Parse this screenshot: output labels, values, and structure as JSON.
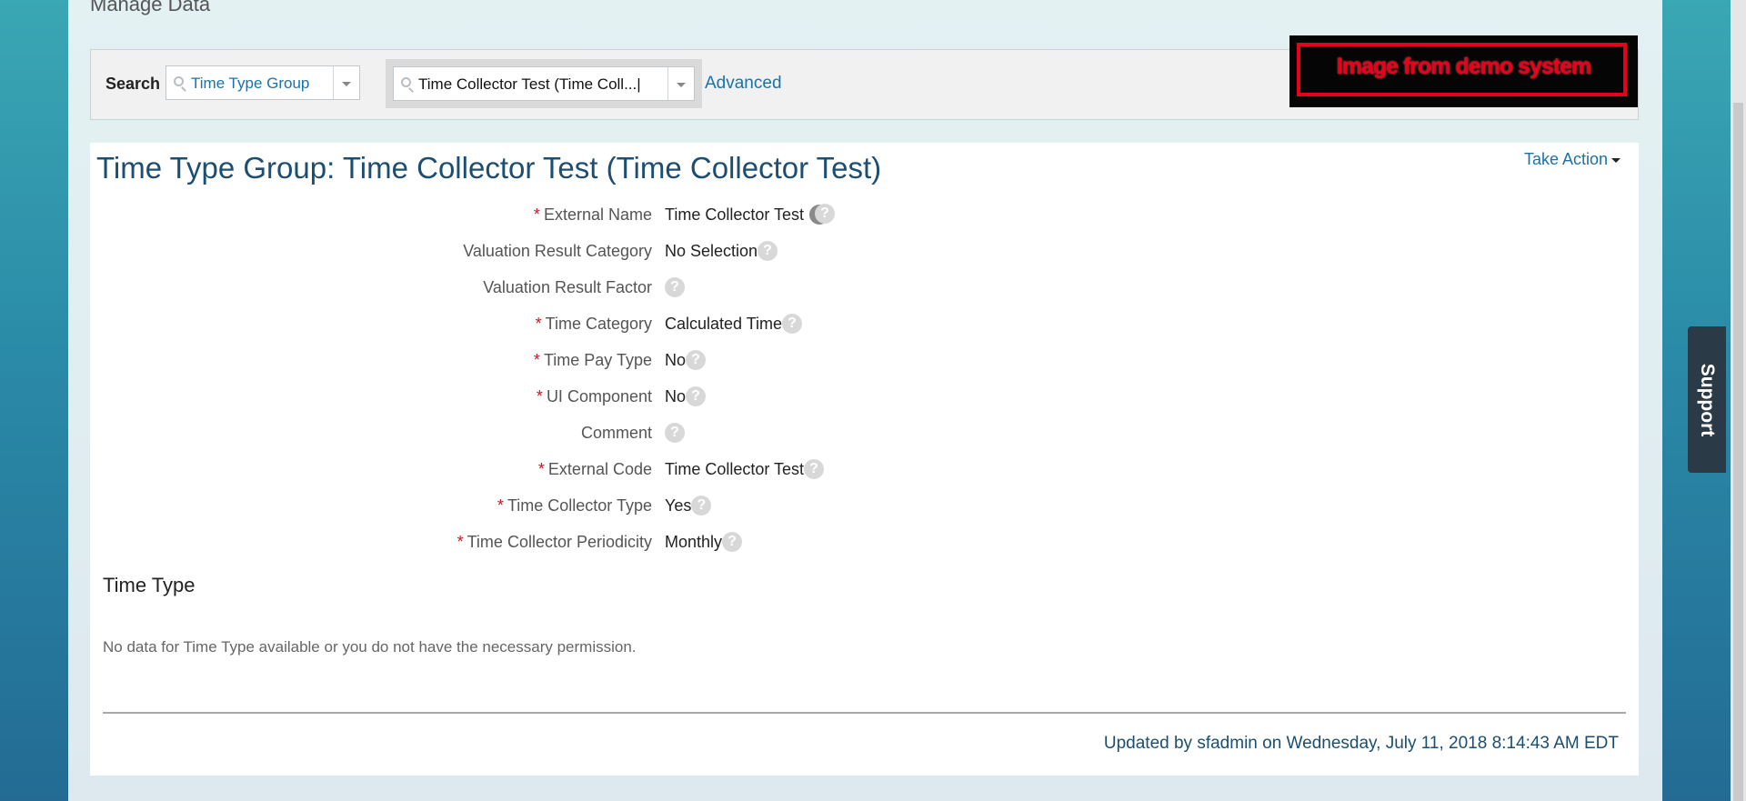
{
  "page": {
    "heading": "Manage Data"
  },
  "search": {
    "label": "Search :",
    "type_value": "Time Type Group",
    "object_value": "Time Collector Test (Time Coll...|",
    "advanced_label": "Advanced"
  },
  "banner": {
    "text": "Image from demo system"
  },
  "record": {
    "title": "Time Type Group: Time Collector Test (Time Collector Test)",
    "take_action_label": "Take Action",
    "fields": [
      {
        "label": "External Name",
        "required": "*",
        "value": "Time Collector Test"
      },
      {
        "label": "Valuation Result Category",
        "required": "",
        "value": "No Selection"
      },
      {
        "label": "Valuation Result Factor",
        "required": "",
        "value": ""
      },
      {
        "label": "Time Category",
        "required": "*",
        "value": "Calculated Time"
      },
      {
        "label": "Time Pay Type",
        "required": "*",
        "value": "No"
      },
      {
        "label": "UI Component",
        "required": "*",
        "value": "No"
      },
      {
        "label": "Comment",
        "required": "",
        "value": ""
      },
      {
        "label": "External Code",
        "required": "*",
        "value": "Time Collector Test"
      },
      {
        "label": "Time Collector Type",
        "required": "*",
        "value": "Yes"
      },
      {
        "label": "Time Collector Periodicity",
        "required": "*",
        "value": "Monthly"
      }
    ],
    "help_glyph": "?"
  },
  "time_type": {
    "section_title": "Time Type",
    "empty_message": "No data for Time Type available or you do not have the necessary permission."
  },
  "footer": {
    "updated_text": "Updated by sfadmin on Wednesday, July 11, 2018 8:14:43 AM EDT"
  },
  "support": {
    "label": "Support"
  },
  "colors": {
    "accent": "#1a73a8",
    "title": "#1c4e72",
    "required": "#d0141e",
    "banner_red": "#e8001a"
  }
}
